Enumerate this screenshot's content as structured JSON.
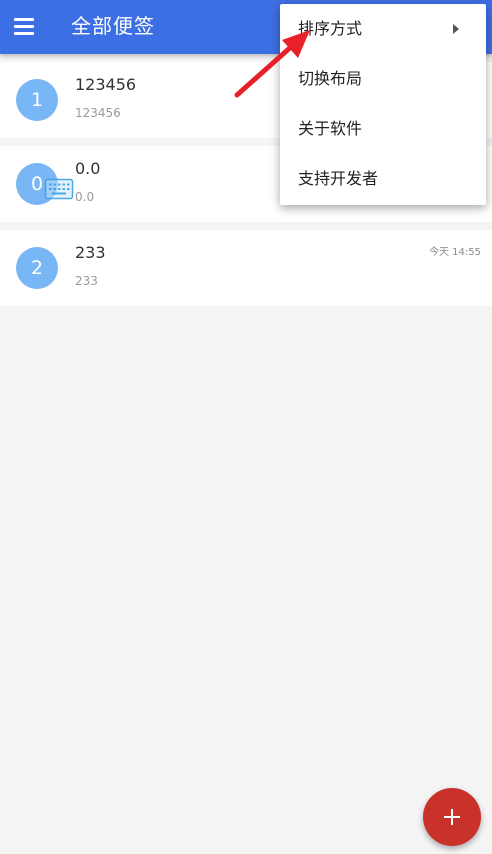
{
  "app": {
    "title": "全部便签"
  },
  "notes": [
    {
      "avatar": "1",
      "title": "123456",
      "preview": "123456",
      "time": ""
    },
    {
      "avatar": "0",
      "title": "0.0",
      "preview": "0.0",
      "time": ""
    },
    {
      "avatar": "2",
      "title": "233",
      "preview": "233",
      "time": "今天 14:55"
    }
  ],
  "menu": {
    "items": [
      {
        "label": "排序方式",
        "has_submenu": true
      },
      {
        "label": "切换布局"
      },
      {
        "label": "关于软件"
      },
      {
        "label": "支持开发者"
      }
    ]
  },
  "icons": {
    "drawer": "hamburger-menu-icon",
    "add": "plus-icon",
    "keyboard_overlay": "keyboard-icon",
    "annotation": "red-arrow-icon",
    "submenu": "triangle-right-icon"
  },
  "colors": {
    "appbar": "#3d6fe4",
    "avatar": "#79b6f5",
    "fab": "#c8322a",
    "background": "#f4f4f5",
    "annotation_arrow": "#e8202a"
  }
}
